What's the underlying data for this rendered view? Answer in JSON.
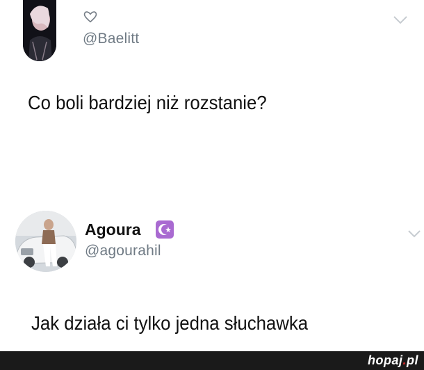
{
  "tweet1": {
    "handle": "@Baelitt",
    "text": "Co boli bardziej niż rozstanie?",
    "icons": [
      "heart-icon",
      "chevron-down-icon"
    ]
  },
  "tweet2": {
    "name": "Agoura",
    "badge_icon": "crescent-star-badge",
    "badge_color": "#a96ad1",
    "handle": "@agourahil",
    "text": "Jak działa ci tylko jedna słuchawka",
    "icons": [
      "chevron-down-icon"
    ]
  },
  "footer": {
    "brand_main": "hopaj",
    "brand_dot": ".",
    "brand_tld": "pl",
    "background": "#1a1a1a",
    "accent": "#e02a2a"
  },
  "colors": {
    "handle": "#6f7a84",
    "text": "#111111",
    "chevron": "#c7ccd1"
  }
}
